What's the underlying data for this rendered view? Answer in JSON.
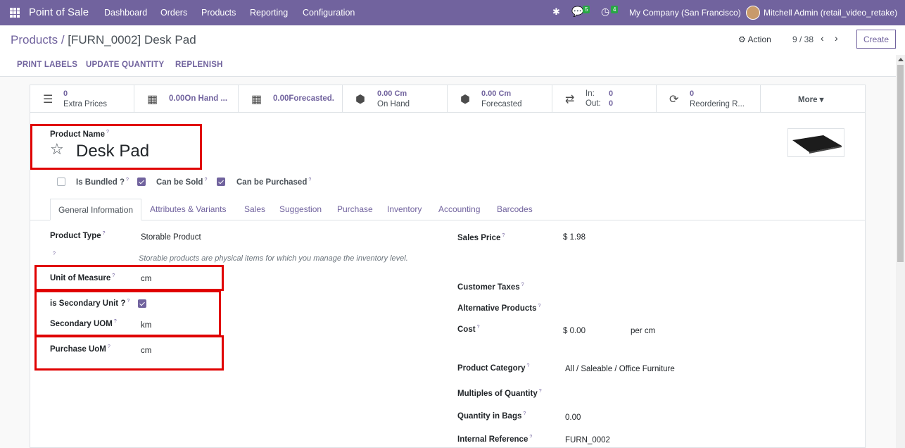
{
  "nav": {
    "app": "Point of Sale",
    "menus": [
      "Dashboard",
      "Orders",
      "Products",
      "Reporting",
      "Configuration"
    ],
    "chat_count": "5",
    "activity_count": "4",
    "company": "My Company (San Francisco)",
    "user": "Mitchell Admin (retail_video_retake)"
  },
  "control": {
    "breadcrumb_parent": "Products",
    "breadcrumb_sep": "/",
    "breadcrumb_current": "[FURN_0002] Desk Pad",
    "action": "Action",
    "pager": "9 / 38",
    "create": "Create"
  },
  "buttons": {
    "print": "PRINT LABELS",
    "update": "UPDATE QUANTITY",
    "replenish": "REPLENISH"
  },
  "stats": [
    {
      "value": "0",
      "label": "Extra Prices",
      "icon": "list-icon"
    },
    {
      "text": "0.00On Hand ...",
      "icon": "cubes-icon"
    },
    {
      "text": "0.00Forecasted.",
      "icon": "cubes-icon"
    },
    {
      "value": "0.00 Cm",
      "label": "On Hand",
      "icon": "boxes-icon"
    },
    {
      "value": "0.00 Cm",
      "label": "Forecasted",
      "icon": "boxes-icon"
    },
    {
      "in_label": "In:",
      "in_value": "0",
      "out_label": "Out:",
      "out_value": "0",
      "icon": "exchange-icon"
    },
    {
      "value": "0",
      "label": "Reordering R...",
      "icon": "refresh-icon"
    },
    {
      "text": "More ▾"
    }
  ],
  "product": {
    "name_label": "Product Name",
    "name": "Desk Pad",
    "is_bundled": "Is Bundled ?",
    "can_sold": "Can be Sold",
    "can_purchased": "Can be Purchased"
  },
  "tabs": [
    "General Information",
    "Attributes & Variants",
    "Sales",
    "Suggestion",
    "Purchase",
    "Inventory",
    "Accounting",
    "Barcodes"
  ],
  "left": {
    "type_label": "Product Type",
    "type_value": "Storable Product",
    "type_note": "Storable products are physical items for which you manage the inventory level.",
    "uom_label": "Unit of Measure",
    "uom_value": "cm",
    "sec_label": "is Secondary Unit ?",
    "suom_label": "Secondary UOM",
    "suom_value": "km",
    "puom_label": "Purchase UoM",
    "puom_value": "cm"
  },
  "right": {
    "price_label": "Sales Price",
    "price_value": "$ 1.98",
    "taxes_label": "Customer Taxes",
    "alt_label": "Alternative Products",
    "cost_label": "Cost",
    "cost_value": "$ 0.00",
    "cost_unit": "per cm",
    "cat_label": "Product Category",
    "cat_value": "All / Saleable / Office Furniture",
    "mult_label": "Multiples of Quantity",
    "bags_label": "Quantity in Bags",
    "bags_value": "0.00",
    "ref_label": "Internal Reference",
    "ref_value": "FURN_0002"
  },
  "help_mark": "?",
  "colors": {
    "brand": "#71639e",
    "highlight": "#e00000",
    "badge": "#28a745"
  }
}
